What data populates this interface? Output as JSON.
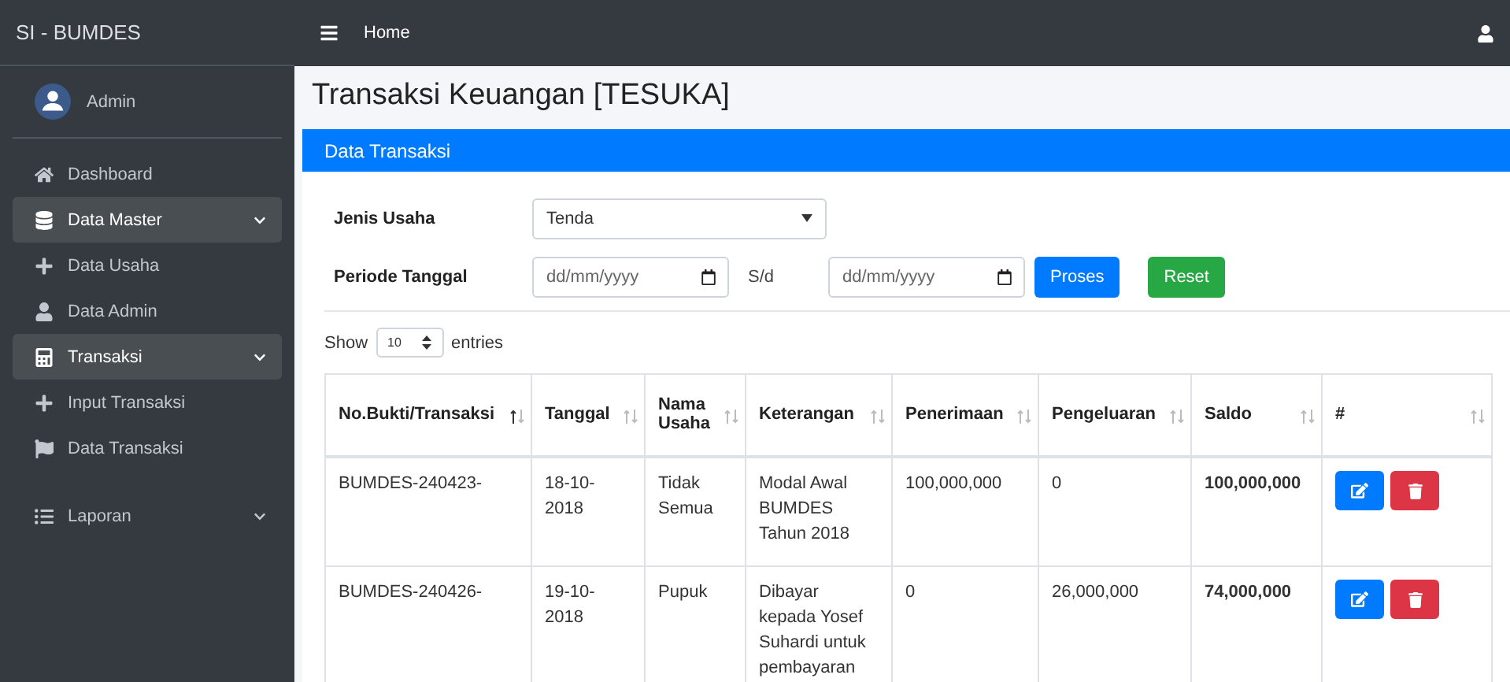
{
  "brand": "SI - BUMDES",
  "user": {
    "name": "Admin"
  },
  "sidebar": {
    "items": [
      {
        "label": "Dashboard"
      },
      {
        "label": "Data Master",
        "expanded": true,
        "children": [
          {
            "label": "Data Usaha"
          },
          {
            "label": "Data Admin"
          }
        ]
      },
      {
        "label": "Transaksi",
        "expanded": true,
        "children": [
          {
            "label": "Input Transaksi"
          },
          {
            "label": "Data Transaksi"
          }
        ]
      },
      {
        "label": "Laporan",
        "expanded": false
      }
    ]
  },
  "navbar": {
    "link": "Home"
  },
  "page_title": "Transaksi Keuangan [TESUKA]",
  "card": {
    "title": "Data Transaksi"
  },
  "filter": {
    "jenis_label": "Jenis Usaha",
    "jenis_value": "Tenda",
    "periode_label": "Periode Tanggal",
    "date_from": {
      "placeholder": "dd/mm/yyyy"
    },
    "separator": "S/d",
    "date_to": {
      "placeholder": "dd/mm/yyyy"
    },
    "buttons": [
      {
        "label": "Proses",
        "kind": "primary"
      },
      {
        "label": "Reset",
        "kind": "success"
      }
    ]
  },
  "length": {
    "prefix": "Show",
    "value": "10",
    "suffix": "entries"
  },
  "table": {
    "columns": [
      {
        "label": "No.Bukti/Transaksi",
        "sorted": true
      },
      {
        "label": "Tanggal",
        "sorted": false
      },
      {
        "label": "Nama Usaha",
        "sorted": false
      },
      {
        "label": "Keterangan",
        "sorted": false
      },
      {
        "label": "Penerimaan",
        "sorted": false
      },
      {
        "label": "Pengeluaran",
        "sorted": false
      },
      {
        "label": "Saldo",
        "sorted": false
      },
      {
        "label": "#",
        "sorted": false
      }
    ],
    "rows": [
      {
        "cells": [
          "BUMDES-240423-",
          "18-10-2018",
          "Tidak Semua",
          "Modal Awal BUMDES Tahun 2018",
          "100,000,000",
          "0",
          "100,000,000"
        ]
      },
      {
        "cells": [
          "BUMDES-240426-",
          "19-10-2018",
          "Pupuk",
          "Dibayar kepada Yosef Suhardi untuk pembayaran",
          "0",
          "26,000,000",
          "74,000,000"
        ]
      }
    ]
  }
}
